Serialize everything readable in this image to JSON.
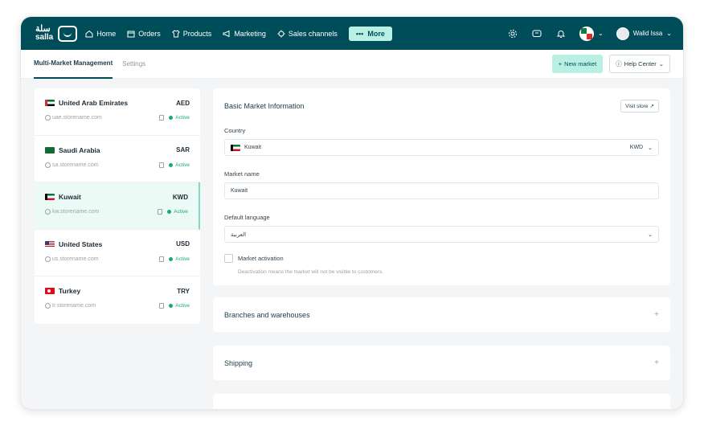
{
  "brand": {
    "name_ar": "سلة",
    "name_en": "salla"
  },
  "nav": [
    {
      "label": "Home",
      "icon": "home-icon"
    },
    {
      "label": "Orders",
      "icon": "box-icon"
    },
    {
      "label": "Products",
      "icon": "shirt-icon"
    },
    {
      "label": "Marketing",
      "icon": "megaphone-icon"
    },
    {
      "label": "Sales channels",
      "icon": "channels-icon"
    }
  ],
  "more_label": "More",
  "user": {
    "name": "Walid Issa"
  },
  "tabs": [
    {
      "label": "Multi-Market Management"
    },
    {
      "label": "Settings"
    }
  ],
  "actions": {
    "new_market": "New market",
    "help_center": "Help Center"
  },
  "markets": [
    {
      "name": "United Arab Emirates",
      "code": "AED",
      "domain": "uae.storename.com",
      "status": "Active",
      "flag": "uae"
    },
    {
      "name": "Saudi Arabia",
      "code": "SAR",
      "domain": "sa.storename.com",
      "status": "Active",
      "flag": "sa"
    },
    {
      "name": "Kuwait",
      "code": "KWD",
      "domain": "kw.storename.com",
      "status": "Active",
      "flag": "kw"
    },
    {
      "name": "United States",
      "code": "USD",
      "domain": "us.storename.com",
      "status": "Active",
      "flag": "us"
    },
    {
      "name": "Turkey",
      "code": "TRY",
      "domain": "tr.storename.com",
      "status": "Active",
      "flag": "tr"
    }
  ],
  "basic": {
    "title": "Basic Market Information",
    "visit_store": "Visit store",
    "country_label": "Country",
    "country_value": "Kuwait",
    "country_currency": "KWD",
    "market_name_label": "Market name",
    "market_name_value": "Kuwait",
    "language_label": "Default language",
    "language_value": "العربية",
    "activation_label": "Market activation",
    "activation_hint": "Deactivation means the market will not be visible to customers."
  },
  "sections": {
    "branches": "Branches and warehouses",
    "shipping": "Shipping"
  },
  "colors": {
    "topbar": "#004d5a",
    "accent": "#b9f0e3",
    "active": "#1ba876"
  }
}
